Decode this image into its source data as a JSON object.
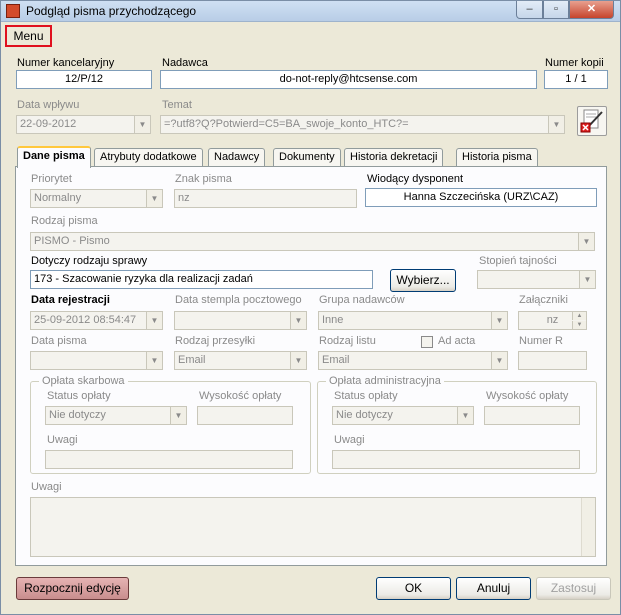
{
  "window": {
    "title": "Podgląd pisma przychodzącego",
    "controls": {
      "minimize": "‒",
      "maximize": "▫",
      "close": "✕"
    }
  },
  "menu": {
    "label": "Menu"
  },
  "header": {
    "numer_kancelaryjny_label": "Numer kancelaryjny",
    "numer_kancelaryjny_value": "12/P/12",
    "nadawca_label": "Nadawca",
    "nadawca_value": "do-not-reply@htcsense.com",
    "numer_kopii_label": "Numer kopii",
    "numer_kopii_value": "1 / 1",
    "data_wplywu_label": "Data wpływu",
    "data_wplywu_value": "22-09-2012",
    "temat_label": "Temat",
    "temat_value": "=?utf8?Q?Potwierd=C5=BA_swoje_konto_HTC?="
  },
  "tabs": [
    {
      "label": "Dane pisma"
    },
    {
      "label": "Atrybuty dodatkowe"
    },
    {
      "label": "Nadawcy"
    },
    {
      "label": "Dokumenty"
    },
    {
      "label": "Historia dekretacji"
    },
    {
      "label": "Historia pisma"
    }
  ],
  "form": {
    "priorytet_label": "Priorytet",
    "priorytet_value": "Normalny",
    "znak_pisma_label": "Znak pisma",
    "znak_pisma_value": "nz",
    "wiodacy_dysponent_label": "Wiodący dysponent",
    "wiodacy_dysponent_value": "Hanna Szczecińska (URZ\\CAZ)",
    "rodzaj_pisma_label": "Rodzaj pisma",
    "rodzaj_pisma_value": "PISMO - Pismo",
    "dotyczy_label": "Dotyczy rodzaju sprawy",
    "dotyczy_value": "173 - Szacowanie ryzyka dla realizacji zadań",
    "wybierz_label": "Wybierz...",
    "stopien_label": "Stopień tajności",
    "stopien_value": "",
    "data_rejestracji_label": "Data rejestracji",
    "data_rejestracji_value": "25-09-2012 08:54:47",
    "data_stempla_label": "Data stempla pocztowego",
    "data_stempla_value": "",
    "grupa_nadawcow_label": "Grupa nadawców",
    "grupa_nadawcow_value": "Inne",
    "zalaczniki_label": "Załączniki",
    "zalaczniki_value": "nz",
    "data_pisma_label": "Data pisma",
    "data_pisma_value": "",
    "rodzaj_przesylki_label": "Rodzaj przesyłki",
    "rodzaj_przesylki_value": "Email",
    "rodzaj_listu_label": "Rodzaj listu",
    "rodzaj_listu_value": "Email",
    "ad_acta_label": "Ad acta",
    "numer_r_label": "Numer R",
    "numer_r_value": "",
    "oplata_skarbowa": {
      "title": "Opłata skarbowa",
      "status_label": "Status opłaty",
      "status_value": "Nie dotyczy",
      "wysokosc_label": "Wysokość opłaty",
      "wysokosc_value": "",
      "uwagi_label": "Uwagi",
      "uwagi_value": ""
    },
    "oplata_administracyjna": {
      "title": "Opłata administracyjna",
      "status_label": "Status opłaty",
      "status_value": "Nie dotyczy",
      "wysokosc_label": "Wysokość opłaty",
      "wysokosc_value": "",
      "uwagi_label": "Uwagi",
      "uwagi_value": ""
    },
    "uwagi_label": "Uwagi"
  },
  "footer": {
    "rozpocznij": "Rozpocznij edycję",
    "ok": "OK",
    "anuluj": "Anuluj",
    "zastosuj": "Zastosuj"
  }
}
